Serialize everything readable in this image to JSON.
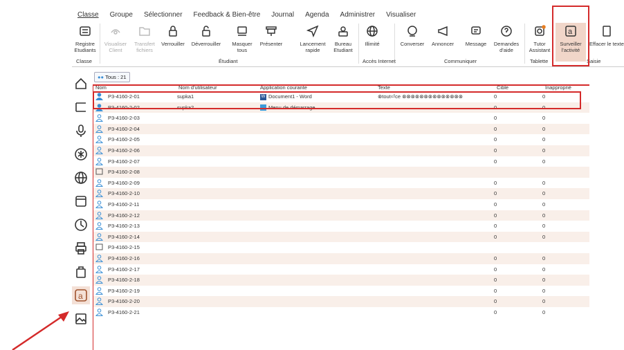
{
  "menu": [
    "Classe",
    "Groupe",
    "Sélectionner",
    "Feedback & Bien-être",
    "Journal",
    "Agenda",
    "Administrer",
    "Visualiser"
  ],
  "ribbon": {
    "registre": "Registre\nEtudiants",
    "visualiser": "Visualiser\nClient",
    "transfert": "Transfert\nfichiers",
    "verrouiller": "Verrouiller",
    "deverrouiller": "Déverrouiller",
    "masquer": "Masquer\ntous",
    "presenter": "Présenter",
    "lancement": "Lancement\nrapide",
    "bureau": "Bureau\nEtudiant",
    "illimite": "Illimité",
    "converser": "Converser",
    "annoncer": "Annoncer",
    "message": "Message",
    "demandes": "Demandes\nd'aide",
    "tutor": "Tutor\nAssistant",
    "surveiller": "Surveiller\nl'activité",
    "effacer": "Effacer le texte",
    "groups": {
      "classe": "Classe",
      "etudiant": "Étudiant",
      "acces": "Accès Internet",
      "communiquer": "Communiquer",
      "tablette": "Tablette",
      "saisie": "Saisie"
    }
  },
  "tous_label": "Tous : 21",
  "table": {
    "headers": [
      "Nom",
      "Nom d'utilisateur",
      "Application courante",
      "Texte",
      "Cible",
      "Inapproprié"
    ],
    "rows": [
      {
        "name": "P3-4160-2-01",
        "user": "supka1",
        "app": "Document1 - Word",
        "text": "⊗tout⏎ce ⊗⊗⊗⊗⊗⊗⊗⊗⊗⊗⊗⊗⊗⊗",
        "cible": "0",
        "inap": "0",
        "icon": "user-active"
      },
      {
        "name": "P3-4160-2-02",
        "user": "supka2",
        "app": "Menu de démarrage",
        "text": "",
        "cible": "0",
        "inap": "0",
        "icon": "user-active"
      },
      {
        "name": "P3-4160-2-03",
        "user": "",
        "app": "",
        "text": "",
        "cible": "0",
        "inap": "0",
        "icon": "user"
      },
      {
        "name": "P3-4160-2-04",
        "user": "",
        "app": "",
        "text": "",
        "cible": "0",
        "inap": "0",
        "icon": "user"
      },
      {
        "name": "P3-4160-2-05",
        "user": "",
        "app": "",
        "text": "",
        "cible": "0",
        "inap": "0",
        "icon": "user"
      },
      {
        "name": "P3-4160-2-06",
        "user": "",
        "app": "",
        "text": "",
        "cible": "0",
        "inap": "0",
        "icon": "user"
      },
      {
        "name": "P3-4160-2-07",
        "user": "",
        "app": "",
        "text": "",
        "cible": "0",
        "inap": "0",
        "icon": "user"
      },
      {
        "name": "P3-4160-2-08",
        "user": "",
        "app": "",
        "text": "",
        "cible": "",
        "inap": "",
        "icon": "screen"
      },
      {
        "name": "P3-4160-2-09",
        "user": "",
        "app": "",
        "text": "",
        "cible": "0",
        "inap": "0",
        "icon": "user"
      },
      {
        "name": "P3-4160-2-10",
        "user": "",
        "app": "",
        "text": "",
        "cible": "0",
        "inap": "0",
        "icon": "user"
      },
      {
        "name": "P3-4160-2-11",
        "user": "",
        "app": "",
        "text": "",
        "cible": "0",
        "inap": "0",
        "icon": "user"
      },
      {
        "name": "P3-4160-2-12",
        "user": "",
        "app": "",
        "text": "",
        "cible": "0",
        "inap": "0",
        "icon": "user"
      },
      {
        "name": "P3-4160-2-13",
        "user": "",
        "app": "",
        "text": "",
        "cible": "0",
        "inap": "0",
        "icon": "user"
      },
      {
        "name": "P3-4160-2-14",
        "user": "",
        "app": "",
        "text": "",
        "cible": "0",
        "inap": "0",
        "icon": "user"
      },
      {
        "name": "P3-4160-2-15",
        "user": "",
        "app": "",
        "text": "",
        "cible": "",
        "inap": "",
        "icon": "screen"
      },
      {
        "name": "P3-4160-2-16",
        "user": "",
        "app": "",
        "text": "",
        "cible": "0",
        "inap": "0",
        "icon": "user"
      },
      {
        "name": "P3-4160-2-17",
        "user": "",
        "app": "",
        "text": "",
        "cible": "0",
        "inap": "0",
        "icon": "user"
      },
      {
        "name": "P3-4160-2-18",
        "user": "",
        "app": "",
        "text": "",
        "cible": "0",
        "inap": "0",
        "icon": "user"
      },
      {
        "name": "P3-4160-2-19",
        "user": "",
        "app": "",
        "text": "",
        "cible": "0",
        "inap": "0",
        "icon": "user"
      },
      {
        "name": "P3-4160-2-20",
        "user": "",
        "app": "",
        "text": "",
        "cible": "0",
        "inap": "0",
        "icon": "user"
      },
      {
        "name": "P3-4160-2-21",
        "user": "",
        "app": "",
        "text": "",
        "cible": "0",
        "inap": "0",
        "icon": "user"
      }
    ]
  },
  "colors": {
    "accent": "#d42a2a",
    "active_bg": "#f1d6c9",
    "user_icon": "#3a8fd6"
  }
}
